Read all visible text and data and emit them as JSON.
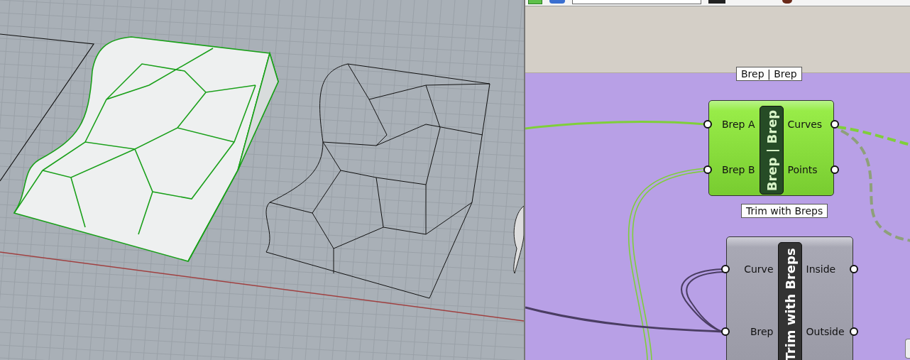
{
  "canvas": {
    "components": [
      {
        "tooltip": "Brep | Brep",
        "name": "Brep | Brep",
        "selected": true,
        "inputs": [
          "Brep A",
          "Brep B"
        ],
        "outputs": [
          "Curves",
          "Points"
        ]
      },
      {
        "tooltip": "Trim with Breps",
        "name": "Trim with Breps",
        "selected": false,
        "inputs": [
          "Curve",
          "Brep"
        ],
        "outputs": [
          "Inside",
          "Outside"
        ]
      }
    ]
  }
}
